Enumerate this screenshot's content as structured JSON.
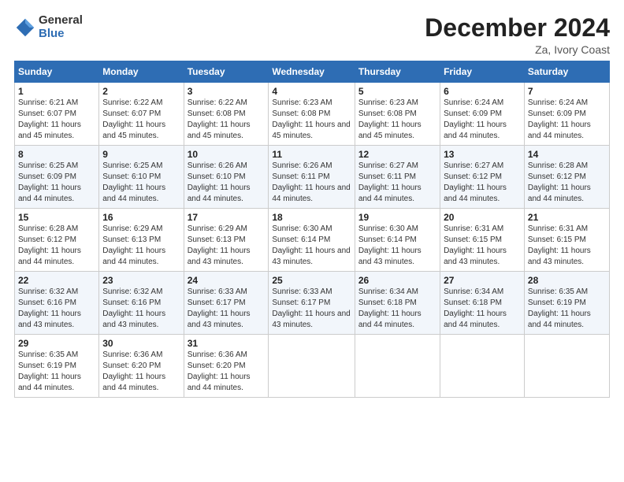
{
  "logo": {
    "general": "General",
    "blue": "Blue"
  },
  "header": {
    "title": "December 2024",
    "location": "Za, Ivory Coast"
  },
  "weekdays": [
    "Sunday",
    "Monday",
    "Tuesday",
    "Wednesday",
    "Thursday",
    "Friday",
    "Saturday"
  ],
  "weeks": [
    [
      {
        "day": "1",
        "sunrise": "6:21 AM",
        "sunset": "6:07 PM",
        "daylight": "11 hours and 45 minutes."
      },
      {
        "day": "2",
        "sunrise": "6:22 AM",
        "sunset": "6:07 PM",
        "daylight": "11 hours and 45 minutes."
      },
      {
        "day": "3",
        "sunrise": "6:22 AM",
        "sunset": "6:08 PM",
        "daylight": "11 hours and 45 minutes."
      },
      {
        "day": "4",
        "sunrise": "6:23 AM",
        "sunset": "6:08 PM",
        "daylight": "11 hours and 45 minutes."
      },
      {
        "day": "5",
        "sunrise": "6:23 AM",
        "sunset": "6:08 PM",
        "daylight": "11 hours and 45 minutes."
      },
      {
        "day": "6",
        "sunrise": "6:24 AM",
        "sunset": "6:09 PM",
        "daylight": "11 hours and 44 minutes."
      },
      {
        "day": "7",
        "sunrise": "6:24 AM",
        "sunset": "6:09 PM",
        "daylight": "11 hours and 44 minutes."
      }
    ],
    [
      {
        "day": "8",
        "sunrise": "6:25 AM",
        "sunset": "6:09 PM",
        "daylight": "11 hours and 44 minutes."
      },
      {
        "day": "9",
        "sunrise": "6:25 AM",
        "sunset": "6:10 PM",
        "daylight": "11 hours and 44 minutes."
      },
      {
        "day": "10",
        "sunrise": "6:26 AM",
        "sunset": "6:10 PM",
        "daylight": "11 hours and 44 minutes."
      },
      {
        "day": "11",
        "sunrise": "6:26 AM",
        "sunset": "6:11 PM",
        "daylight": "11 hours and 44 minutes."
      },
      {
        "day": "12",
        "sunrise": "6:27 AM",
        "sunset": "6:11 PM",
        "daylight": "11 hours and 44 minutes."
      },
      {
        "day": "13",
        "sunrise": "6:27 AM",
        "sunset": "6:12 PM",
        "daylight": "11 hours and 44 minutes."
      },
      {
        "day": "14",
        "sunrise": "6:28 AM",
        "sunset": "6:12 PM",
        "daylight": "11 hours and 44 minutes."
      }
    ],
    [
      {
        "day": "15",
        "sunrise": "6:28 AM",
        "sunset": "6:12 PM",
        "daylight": "11 hours and 44 minutes."
      },
      {
        "day": "16",
        "sunrise": "6:29 AM",
        "sunset": "6:13 PM",
        "daylight": "11 hours and 44 minutes."
      },
      {
        "day": "17",
        "sunrise": "6:29 AM",
        "sunset": "6:13 PM",
        "daylight": "11 hours and 43 minutes."
      },
      {
        "day": "18",
        "sunrise": "6:30 AM",
        "sunset": "6:14 PM",
        "daylight": "11 hours and 43 minutes."
      },
      {
        "day": "19",
        "sunrise": "6:30 AM",
        "sunset": "6:14 PM",
        "daylight": "11 hours and 43 minutes."
      },
      {
        "day": "20",
        "sunrise": "6:31 AM",
        "sunset": "6:15 PM",
        "daylight": "11 hours and 43 minutes."
      },
      {
        "day": "21",
        "sunrise": "6:31 AM",
        "sunset": "6:15 PM",
        "daylight": "11 hours and 43 minutes."
      }
    ],
    [
      {
        "day": "22",
        "sunrise": "6:32 AM",
        "sunset": "6:16 PM",
        "daylight": "11 hours and 43 minutes."
      },
      {
        "day": "23",
        "sunrise": "6:32 AM",
        "sunset": "6:16 PM",
        "daylight": "11 hours and 43 minutes."
      },
      {
        "day": "24",
        "sunrise": "6:33 AM",
        "sunset": "6:17 PM",
        "daylight": "11 hours and 43 minutes."
      },
      {
        "day": "25",
        "sunrise": "6:33 AM",
        "sunset": "6:17 PM",
        "daylight": "11 hours and 43 minutes."
      },
      {
        "day": "26",
        "sunrise": "6:34 AM",
        "sunset": "6:18 PM",
        "daylight": "11 hours and 44 minutes."
      },
      {
        "day": "27",
        "sunrise": "6:34 AM",
        "sunset": "6:18 PM",
        "daylight": "11 hours and 44 minutes."
      },
      {
        "day": "28",
        "sunrise": "6:35 AM",
        "sunset": "6:19 PM",
        "daylight": "11 hours and 44 minutes."
      }
    ],
    [
      {
        "day": "29",
        "sunrise": "6:35 AM",
        "sunset": "6:19 PM",
        "daylight": "11 hours and 44 minutes."
      },
      {
        "day": "30",
        "sunrise": "6:36 AM",
        "sunset": "6:20 PM",
        "daylight": "11 hours and 44 minutes."
      },
      {
        "day": "31",
        "sunrise": "6:36 AM",
        "sunset": "6:20 PM",
        "daylight": "11 hours and 44 minutes."
      },
      null,
      null,
      null,
      null
    ]
  ]
}
